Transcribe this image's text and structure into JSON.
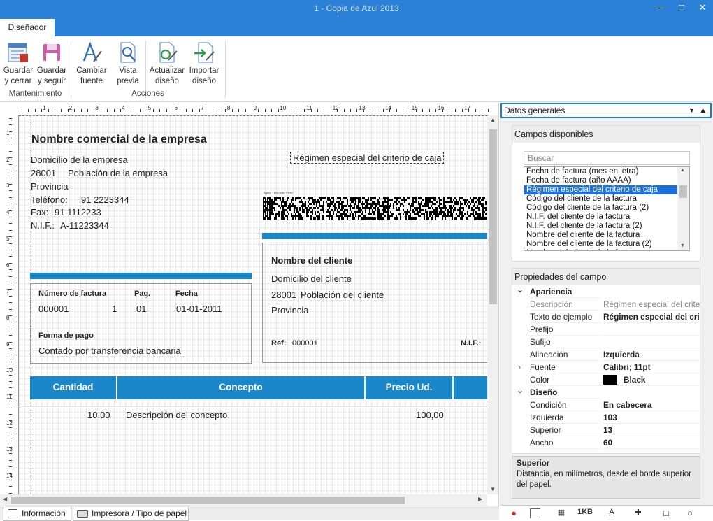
{
  "window": {
    "title": "1 - Copia de Azul 2013"
  },
  "tabs": {
    "active": "Diseñador"
  },
  "ribbon": {
    "groups": {
      "mantenimiento": "Mantenimiento",
      "acciones": "Acciones"
    },
    "buttons": {
      "guardar_cerrar": [
        "Guardar",
        "y cerrar"
      ],
      "guardar_seguir": [
        "Guardar",
        "y seguir"
      ],
      "cambiar_fuente": [
        "Cambiar",
        "fuente"
      ],
      "vista_previa": [
        "Vista",
        "previa"
      ],
      "actualizar": [
        "Actualizar",
        "diseño"
      ],
      "importar": [
        "Importar",
        "diseño"
      ]
    }
  },
  "ruler": {
    "top": [
      "1",
      "2",
      "3",
      "4",
      "5",
      "6",
      "7",
      "8",
      "9",
      "10",
      "11",
      "12",
      "13",
      "14",
      "15",
      "16",
      "17"
    ],
    "left": [
      "1",
      "2",
      "3",
      "4",
      "5",
      "6",
      "7",
      "8",
      "9",
      "10",
      "11",
      "12",
      "13",
      "14"
    ]
  },
  "invoice": {
    "company_name": "Nombre comercial de la empresa",
    "address": "Domicilio de la empresa",
    "zip": "28001",
    "city": "Población de la empresa",
    "province": "Provincia",
    "phone_label": "Teléfono:",
    "phone": "91 2223344",
    "fax_label": "Fax:",
    "fax": "91 1112233",
    "nif_label": "N.I.F.:",
    "nif": "A-11223344",
    "regime": "Régimen especial del criterio de caja",
    "barcode_caption": "www.1kbcode.com",
    "client_name": "Nombre del cliente",
    "client_address": "Domicilio del cliente",
    "client_zip": "28001",
    "client_city": "Población del cliente",
    "client_province": "Provincia",
    "ref_label": "Ref:",
    "ref": "000001",
    "client_nif_label": "N.I.F.:",
    "invoice_number_label": "Número de factura",
    "page_label": "Pag.",
    "date_label": "Fecha",
    "invoice_number": "000001",
    "page": "1",
    "page_total": "01",
    "date": "01-01-2011",
    "payment_label": "Forma de pago",
    "payment": "Contado por transferencia bancaria",
    "columns": [
      "Cantidad",
      "Concepto",
      "Precio Ud."
    ],
    "line": {
      "qty": "10,00",
      "concept": "Descripción del concepto",
      "price": "100,00"
    }
  },
  "bottom_tabs": [
    "Información",
    "Impresora / Tipo de papel"
  ],
  "panel": {
    "dropdown": "Datos generales",
    "fields_header": "Campos disponibles",
    "search_placeholder": "Buscar",
    "fields": [
      {
        "label": "Fecha de factura (mes en letra)",
        "selected": false
      },
      {
        "label": "Fecha de factura (año AAAA)",
        "selected": false
      },
      {
        "label": "Régimen especial del criterio de caja",
        "selected": true
      },
      {
        "label": "Código del cliente de la factura",
        "selected": false
      },
      {
        "label": "Código del cliente de la factura (2)",
        "selected": false
      },
      {
        "label": "N.I.F. del cliente de la factura",
        "selected": false
      },
      {
        "label": "N.I.F. del cliente de la factura (2)",
        "selected": false
      },
      {
        "label": "Nombre del cliente de la factura",
        "selected": false
      },
      {
        "label": "Nombre del cliente de la factura (2)",
        "selected": false
      },
      {
        "label": "Nombre del cliente de la factura",
        "selected": false
      }
    ],
    "props_header": "Propiedades del campo",
    "props": [
      {
        "type": "cat",
        "name": "Apariencia",
        "expanded": true
      },
      {
        "type": "prop",
        "name": "Descripción",
        "value": "Régimen especial del criterio de caja",
        "muted": true
      },
      {
        "type": "prop",
        "name": "Texto de ejemplo",
        "value": "Régimen especial del criterio de caja"
      },
      {
        "type": "prop",
        "name": "Prefijo",
        "value": ""
      },
      {
        "type": "prop",
        "name": "Sufijo",
        "value": ""
      },
      {
        "type": "prop",
        "name": "Alineación",
        "value": "Izquierda"
      },
      {
        "type": "prop",
        "name": "Fuente",
        "value": "Calibri; 11pt",
        "expandable": true
      },
      {
        "type": "prop",
        "name": "Color",
        "value": "Black",
        "swatch": "#000000"
      },
      {
        "type": "cat",
        "name": "Diseño",
        "expanded": true
      },
      {
        "type": "prop",
        "name": "Condición",
        "value": "En cabecera"
      },
      {
        "type": "prop",
        "name": "Izquierda",
        "value": "103"
      },
      {
        "type": "prop",
        "name": "Superior",
        "value": "13"
      },
      {
        "type": "prop",
        "name": "Ancho",
        "value": "60"
      }
    ],
    "desc_title": "Superior",
    "desc_text": "Distancia, en milímetros, desde el borde superior del papel.",
    "bottom_icon_label": "1KB"
  },
  "colors": {
    "accent": "#2b80d8",
    "brand_blue": "#1a87c9",
    "selection": "#1e6fd6"
  }
}
